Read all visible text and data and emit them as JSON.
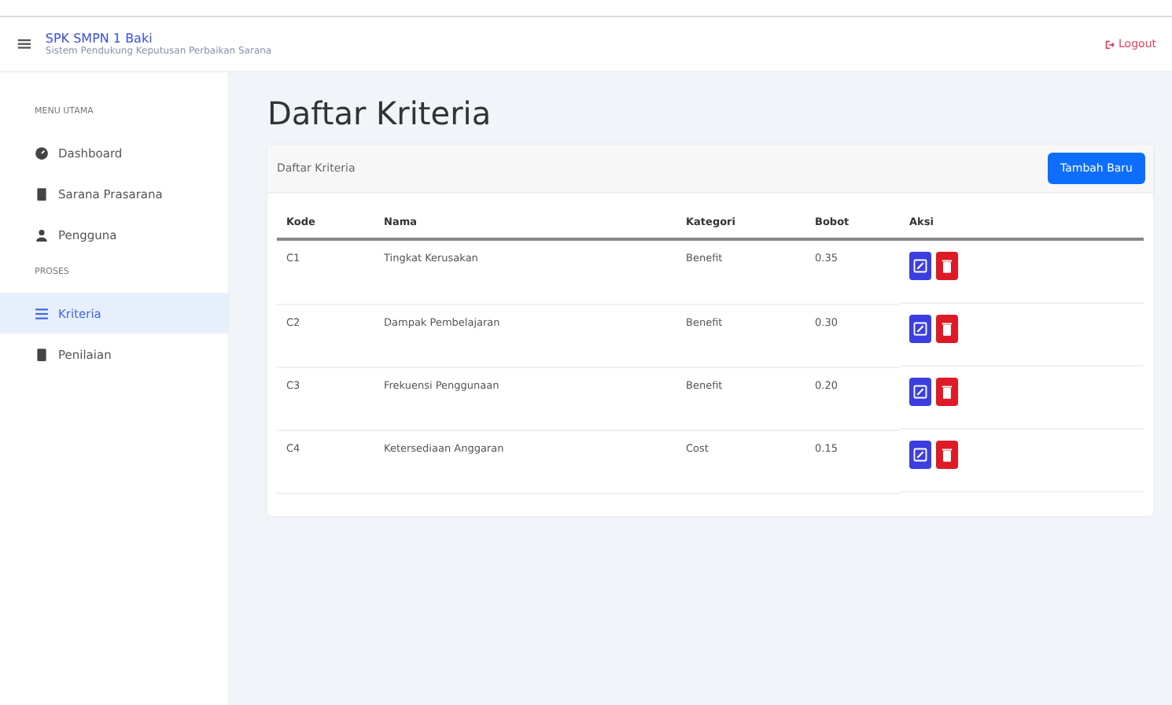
{
  "header": {
    "menu_icon": "≡",
    "title": "SPK SMPN 1 Baki",
    "subtitle": "Sistem Pendukung Keputusan Perbaikan Sarana",
    "logout": "Logout"
  },
  "sidebar": {
    "sections": [
      {
        "heading": "MENU UTAMA",
        "items": [
          {
            "label": "Dashboard",
            "kind": "dashboard",
            "selected": false
          },
          {
            "label": "Sarana Prasarana",
            "kind": "doc",
            "selected": false
          },
          {
            "label": "Pengguna",
            "kind": "user",
            "selected": false
          }
        ]
      },
      {
        "heading": "PROSES",
        "items": [
          {
            "label": "Kriteria",
            "kind": "list",
            "selected": true
          },
          {
            "label": "Penilaian",
            "kind": "doc",
            "selected": false
          }
        ]
      }
    ]
  },
  "page_title": "Daftar Kriteria",
  "card": {
    "title": "Daftar Kriteria",
    "add_button": "Tambah Baru",
    "table": {
      "columns": [
        "Kode",
        "Nama",
        "Kategori",
        "Bobot",
        "Aksi"
      ],
      "rows": [
        {
          "kode": "C1",
          "nama": "Tingkat Kerusakan",
          "kategori": "Benefit",
          "bobot": "0.35"
        },
        {
          "kode": "C2",
          "nama": "Dampak Pembelajaran",
          "kategori": "Benefit",
          "bobot": "0.30"
        },
        {
          "kode": "C3",
          "nama": "Frekuensi Penggunaan",
          "kategori": "Benefit",
          "bobot": "0.20"
        },
        {
          "kode": "C4",
          "nama": "Ketersediaan Anggaran",
          "kategori": "Cost",
          "bobot": "0.15"
        }
      ]
    }
  }
}
